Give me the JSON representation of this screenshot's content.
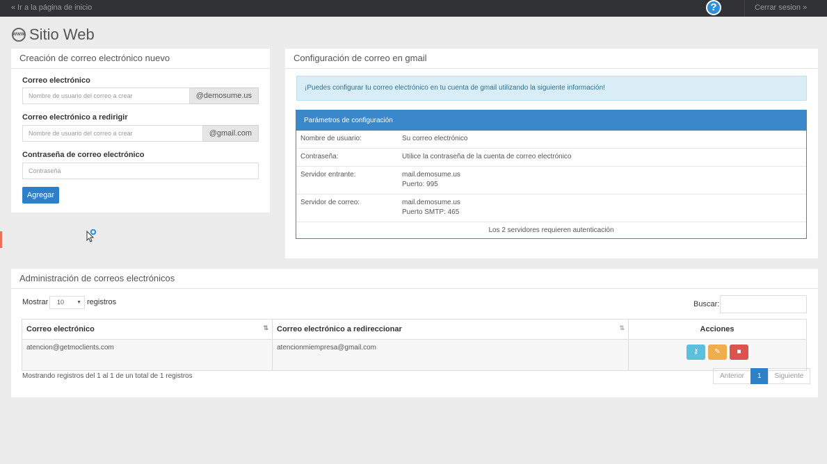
{
  "topbar": {
    "home_link": "« Ir a la página de inicio",
    "help_symbol": "?",
    "logout": "Cerrar sesion »"
  },
  "page": {
    "icon_text": "WWW",
    "title": "Sitio Web"
  },
  "new_email_panel": {
    "title": "Creación de correo electrónico nuevo",
    "email_label": "Correo electrónico",
    "email_placeholder": "Nombre de usuario del correo a crear",
    "email_domain": "@demosume.us",
    "redirect_label": "Correo electrónico a redirigir",
    "redirect_placeholder": "Nombre de usuario del correo a crear",
    "redirect_domain": "@gmail.com",
    "password_label": "Contraseña de correo electrónico",
    "password_placeholder": "Contraseña",
    "add_button": "Agregar"
  },
  "gmail_panel": {
    "title": "Configuración de correo en gmail",
    "alert": "¡Puedes configurar tu correo electrónico en tu cuenta de gmail utilizando la siguiente información!",
    "params_title": "Parámetros de configuración",
    "rows": [
      {
        "key": "Nombre de usuario:",
        "value": "Su correo electrónico",
        "value2": ""
      },
      {
        "key": "Contraseña:",
        "value": "Utilice la contraseña de la cuenta de correo electrónico",
        "value2": ""
      },
      {
        "key": "Servidor entrante:",
        "value": "mail.demosume.us",
        "value2": "Puerto: 995"
      },
      {
        "key": "Servidor de correo:",
        "value": "mail.demosume.us",
        "value2": "Puerto SMTP: 465"
      }
    ],
    "footer": "Los 2 servidores requieren autenticación"
  },
  "admin_panel": {
    "title": "Administración de correos electrónicos",
    "show_label": "Mostrar",
    "show_value": "10",
    "records_label": "registros",
    "search_label": "Buscar:",
    "columns": [
      "Correo electrónico",
      "Correo electrónico a redireccionar",
      "Acciones"
    ],
    "rows": [
      {
        "email": "atencion@getmoclients.com",
        "redirect": "atencionmiempresa@gmail.com"
      }
    ],
    "info": "Mostrando registros del 1 al 1 de un total de 1 registros",
    "pager": {
      "prev": "Anterior",
      "page": "1",
      "next": "Siguiente"
    }
  }
}
